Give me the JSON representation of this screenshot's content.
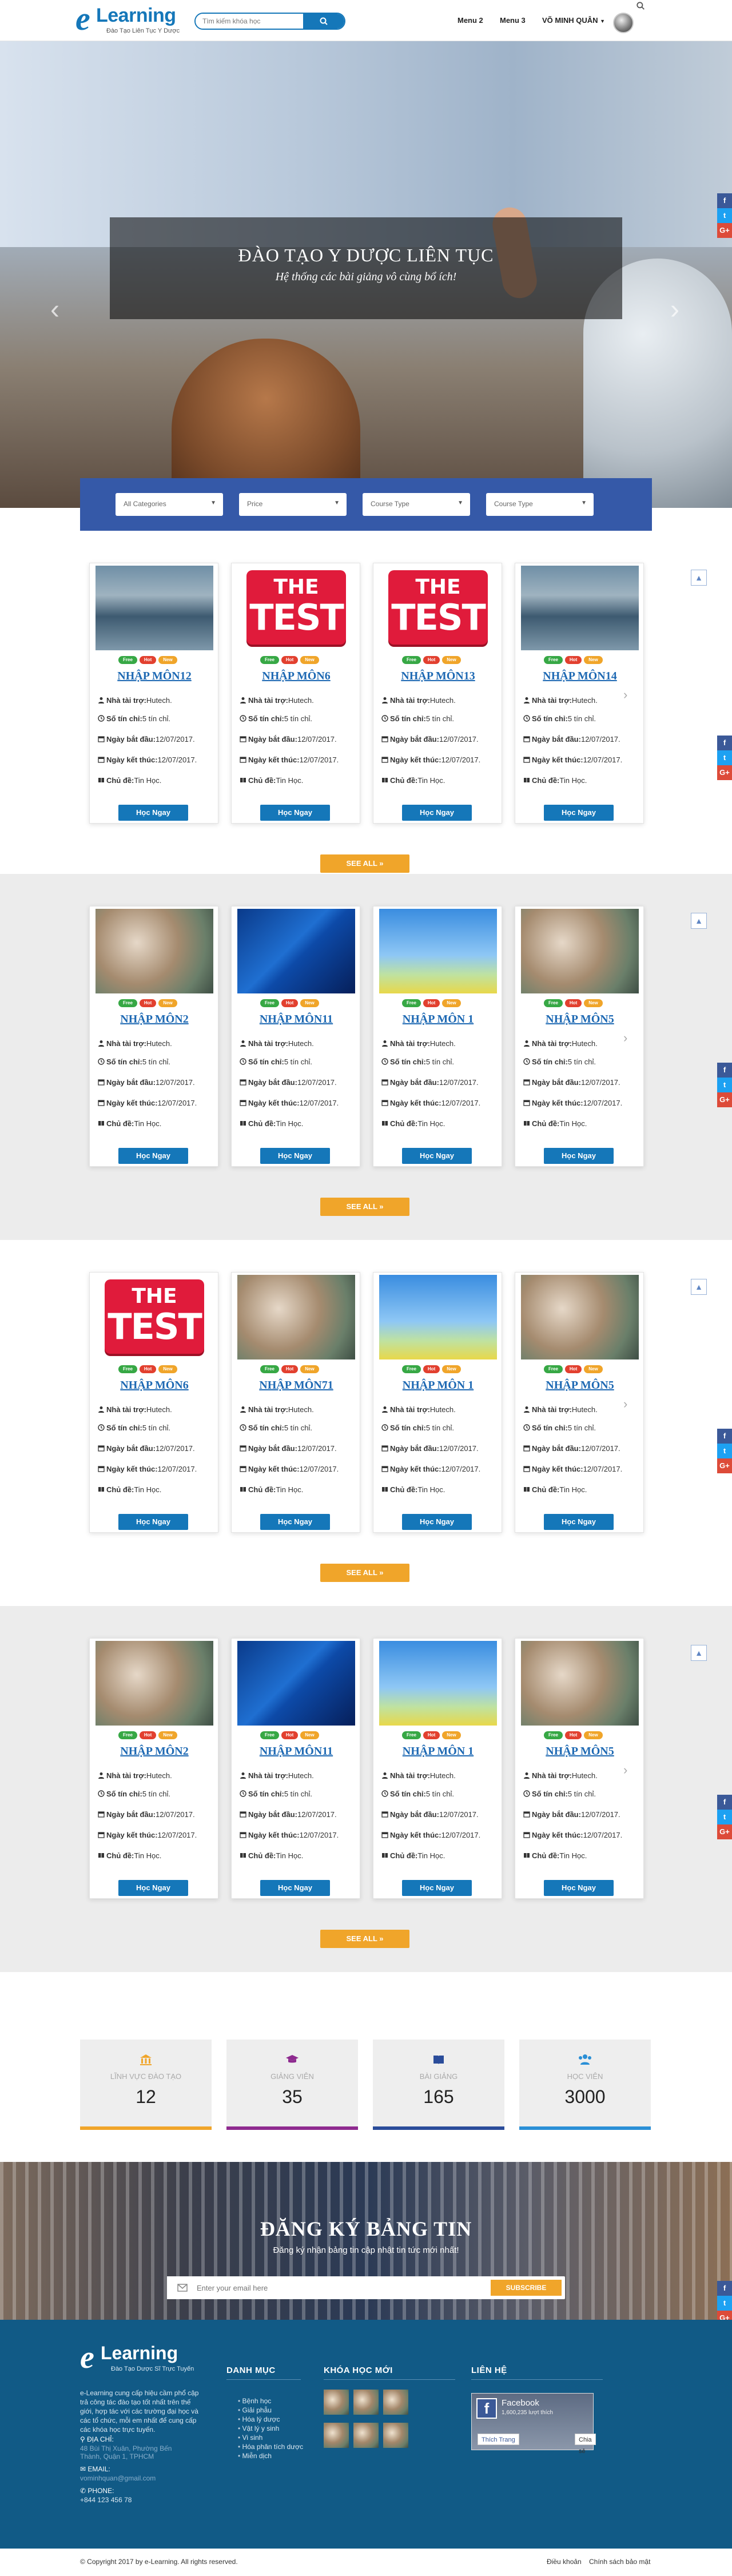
{
  "header": {
    "logo_word": "Learning",
    "logo_tag": "Đào Tạo Liên Tục Y Dược",
    "search_placeholder": "Tìm kiếm khóa học",
    "menu": [
      "Menu 2",
      "Menu 3"
    ],
    "user_name": "VÕ MINH QUÂN"
  },
  "hero": {
    "title": "ĐÀO TẠO Y DƯỢC LIÊN TỤC",
    "subtitle": "Hệ thống các bài giảng vô cùng bổ ích!"
  },
  "filters": [
    "All Categories",
    "Price",
    "Course Type",
    "Course Type"
  ],
  "labels": {
    "sponsor": "Nhà tài trợ:",
    "credits": "Số tín chỉ:",
    "start": "Ngày bắt đầu:",
    "end": "Ngày kết thúc:",
    "topic": "Chủ đề:",
    "btn": "Học Ngay",
    "see_all": "SEE ALL »",
    "tag_free": "Free",
    "tag_hot": "Hot",
    "tag_new": "New"
  },
  "sections": [
    {
      "cards": [
        {
          "title": "NHẬP MÔN12",
          "img": "lake"
        },
        {
          "title": "NHẬP MÔN6",
          "img": "test"
        },
        {
          "title": "NHẬP MÔN13",
          "img": "test"
        },
        {
          "title": "NHẬP MÔN14",
          "img": "lake"
        }
      ]
    },
    {
      "cards": [
        {
          "title": "NHẬP MÔN2",
          "img": "lab"
        },
        {
          "title": "NHẬP MÔN11",
          "img": "blue"
        },
        {
          "title": "NHẬP MÔN 1",
          "img": "city"
        },
        {
          "title": "NHẬP MÔN5",
          "img": "lab"
        }
      ]
    },
    {
      "cards": [
        {
          "title": "NHẬP MÔN6",
          "img": "test"
        },
        {
          "title": "NHẬP MÔN71",
          "img": "lab"
        },
        {
          "title": "NHẬP MÔN 1",
          "img": "city"
        },
        {
          "title": "NHẬP MÔN5",
          "img": "lab"
        }
      ]
    },
    {
      "cards": [
        {
          "title": "NHẬP MÔN2",
          "img": "lab"
        },
        {
          "title": "NHẬP MÔN11",
          "img": "blue"
        },
        {
          "title": "NHẬP MÔN 1",
          "img": "city"
        },
        {
          "title": "NHẬP MÔN5",
          "img": "lab"
        }
      ]
    }
  ],
  "card_values": {
    "sponsor": "Hutech.",
    "credits": "5 tín chỉ.",
    "start": "12/07/2017.",
    "end": "12/07/2017.",
    "topic": "Tin Học."
  },
  "test_badge": {
    "line1": "THE",
    "line2": "TEST"
  },
  "stats": [
    {
      "label": "LĨNH VỰC ĐÀO TẠO",
      "value": "12",
      "color": "#f0a52a",
      "icon": "bank-icon"
    },
    {
      "label": "GIẢNG VIÊN",
      "value": "35",
      "color": "#8e2a8f",
      "icon": "graduation-cap-icon"
    },
    {
      "label": "BÀI GIẢNG",
      "value": "165",
      "color": "#2a4c9a",
      "icon": "book-icon"
    },
    {
      "label": "HỌC VIÊN",
      "value": "3000",
      "color": "#2a8fd6",
      "icon": "users-icon"
    }
  ],
  "newsletter": {
    "title": "ĐĂNG KÝ BẢNG TIN",
    "subtitle": "Đăng ký nhận bảng tin cập nhật tin tức mới nhất!",
    "placeholder": "Enter your email here",
    "button": "SUBSCRIBE"
  },
  "footer": {
    "logo_word": "Learning",
    "logo_tag": "Đào Tạo Dược Sĩ Trực Tuyến",
    "about": "e-Learning cung cấp hiệu cầm phổ cập trả công tác đào tạo tốt nhất trên thế giới, hợp tác với các trường đại học và các tổ chức, mỗi em nhất để cung cấp các khóa học trực tuyến.",
    "address_label": "ĐỊA CHỈ:",
    "address": "48 Bùi Thị Xuân, Phường Bến Thành, Quận 1, TPHCM",
    "email_label": "EMAIL:",
    "email": "vominhquan@gmail.com",
    "phone_label": "PHONE:",
    "phone": "+844 123 456 78",
    "col_menu": "DANH MỤC",
    "col_courses": "KHÓA HỌC MỚI",
    "col_contact": "LIÊN HỆ",
    "menu_items": [
      "Bệnh học",
      "Giải phẫu",
      "Hóa lý dược",
      "Vật lý y sinh",
      "Vi sinh",
      "Hóa phân tích dược",
      "Miễn dịch"
    ],
    "fb_name": "Facebook",
    "fb_likes": "1,600,235 lượt thích",
    "fb_like": "Thích Trang",
    "fb_share": "Chia sẻ",
    "copyright": "© Copyright 2017 by e-Learning. All rights reserved.",
    "links": [
      "Điều khoản",
      "Chính sách bảo mật"
    ]
  }
}
